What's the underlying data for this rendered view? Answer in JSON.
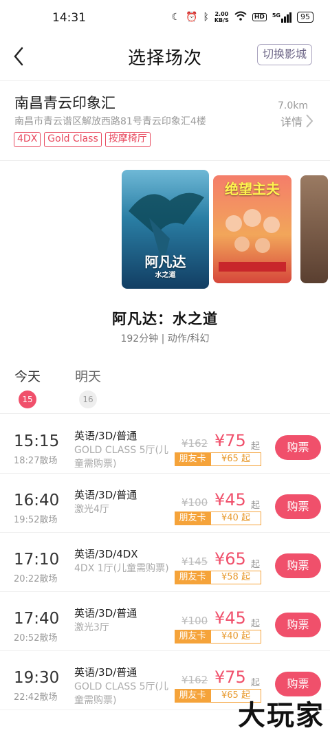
{
  "status_bar": {
    "time": "14:31",
    "net_speed_value": "2.00",
    "net_speed_unit": "KB/S",
    "hd": "HD",
    "signal": "5G",
    "battery": "95"
  },
  "nav": {
    "title": "选择场次",
    "switch_button": "切换影城"
  },
  "cinema": {
    "name": "南昌青云印象汇",
    "address": "南昌市青云谱区解放西路81号青云印象汇4楼",
    "distance": "7.0km",
    "detail_label": "详情",
    "tags": [
      "4DX",
      "Gold Class",
      "按摩椅厅"
    ]
  },
  "posters": [
    {
      "title": "阿凡达",
      "subtitle": "水之道"
    },
    {
      "title": "绝望主夫",
      "subtitle": ""
    },
    {
      "title": "",
      "subtitle": ""
    }
  ],
  "movie": {
    "title": "阿凡达：水之道",
    "meta": "192分钟 | 动作/科幻"
  },
  "dates": [
    {
      "label": "今天",
      "day": "15"
    },
    {
      "label": "明天",
      "day": "16"
    }
  ],
  "showtimes": [
    {
      "start": "15:15",
      "end": "18:27散场",
      "lang": "英语/3D/普通",
      "hall": "GOLD CLASS 5厅(儿童需购票)",
      "orig_price": "¥162",
      "price": "¥75",
      "suffix": "起",
      "member_label": "朋友卡",
      "member_price": "¥65 起",
      "buy": "购票"
    },
    {
      "start": "16:40",
      "end": "19:52散场",
      "lang": "英语/3D/普通",
      "hall": "激光4厅",
      "orig_price": "¥100",
      "price": "¥45",
      "suffix": "起",
      "member_label": "朋友卡",
      "member_price": "¥40 起",
      "buy": "购票"
    },
    {
      "start": "17:10",
      "end": "20:22散场",
      "lang": "英语/3D/4DX",
      "hall": "4DX 1厅(儿童需购票)",
      "orig_price": "¥145",
      "price": "¥65",
      "suffix": "起",
      "member_label": "朋友卡",
      "member_price": "¥58 起",
      "buy": "购票"
    },
    {
      "start": "17:40",
      "end": "20:52散场",
      "lang": "英语/3D/普通",
      "hall": "激光3厅",
      "orig_price": "¥100",
      "price": "¥45",
      "suffix": "起",
      "member_label": "朋友卡",
      "member_price": "¥40 起",
      "buy": "购票"
    },
    {
      "start": "19:30",
      "end": "22:42散场",
      "lang": "英语/3D/普通",
      "hall": "GOLD CLASS 5厅(儿童需购票)",
      "orig_price": "¥162",
      "price": "¥75",
      "suffix": "起",
      "member_label": "朋友卡",
      "member_price": "¥65 起",
      "buy": "购票"
    }
  ],
  "watermark": "大玩家",
  "colors": {
    "accent": "#f0506b",
    "member": "#f5a33a",
    "muted": "#999999"
  }
}
